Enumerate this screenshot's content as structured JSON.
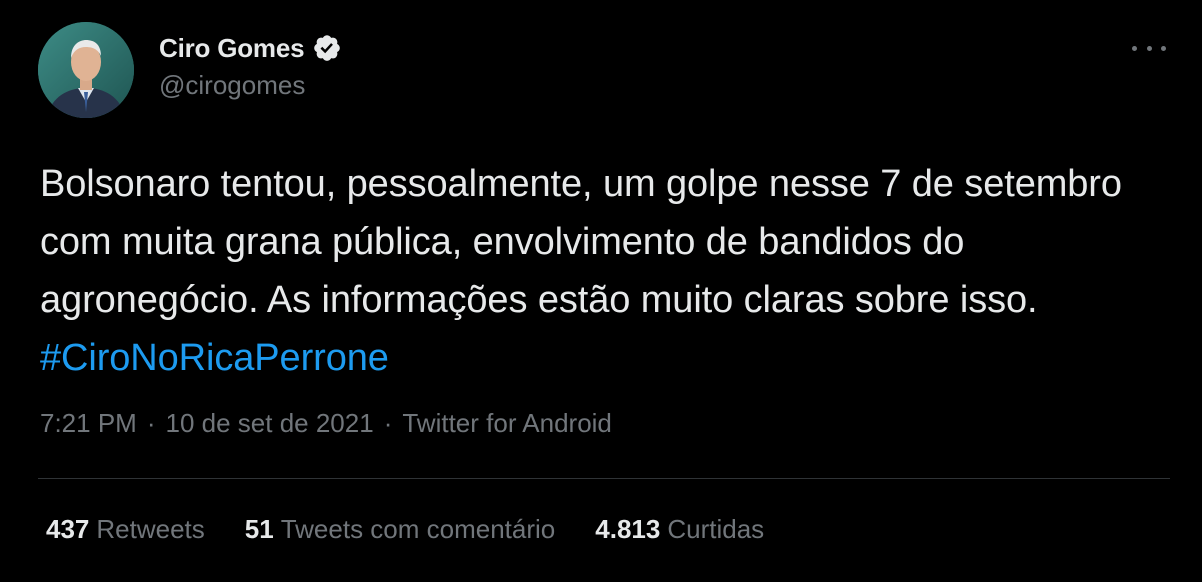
{
  "author": {
    "display_name": "Ciro Gomes",
    "handle": "@cirogomes",
    "verified": true
  },
  "tweet": {
    "text": "Bolsonaro tentou, pessoalmente, um golpe nesse 7 de setembro com muita grana pública, envolvimento de bandidos do agronegócio. As informações estão muito claras sobre isso.",
    "hashtag": "#CiroNoRicaPerrone"
  },
  "meta": {
    "time": "7:21 PM",
    "separator": "·",
    "date": "10 de set de 2021",
    "source": "Twitter for Android"
  },
  "stats": {
    "retweets_count": "437",
    "retweets_label": "Retweets",
    "quotes_count": "51",
    "quotes_label": "Tweets com comentário",
    "likes_count": "4.813",
    "likes_label": "Curtidas"
  },
  "icons": {
    "verified": "verified-badge-icon",
    "more": "more-options-icon"
  },
  "colors": {
    "background": "#000000",
    "text_primary": "#e7e9ea",
    "text_secondary": "#71767b",
    "accent": "#1d9bf0",
    "divider": "#2f3336"
  }
}
